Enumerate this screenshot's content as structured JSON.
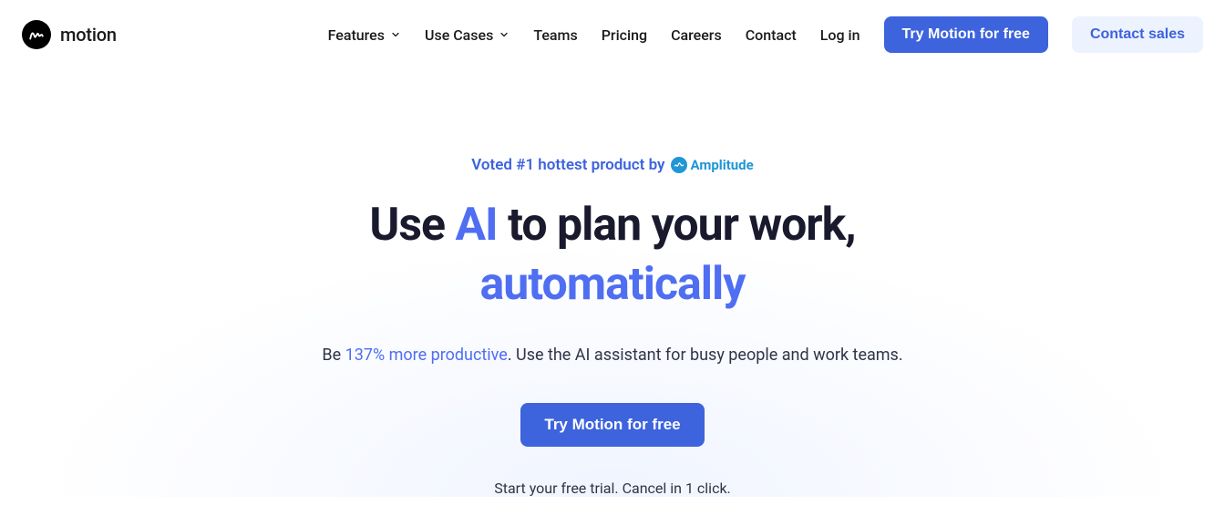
{
  "brand": {
    "name": "motion"
  },
  "nav": {
    "features": "Features",
    "usecases": "Use Cases",
    "teams": "Teams",
    "pricing": "Pricing",
    "careers": "Careers",
    "contact": "Contact",
    "login": "Log in",
    "try": "Try Motion for free",
    "sales": "Contact sales"
  },
  "hero": {
    "badge_prefix": "Voted #1 hottest product by",
    "badge_partner": "Amplitude",
    "headline_pre": "Use ",
    "headline_accent1": "AI",
    "headline_mid": " to plan your work,",
    "headline_accent2": "automatically",
    "sub_pre": "Be ",
    "sub_accent": "137% more productive",
    "sub_post": ". Use the AI assistant for busy people and work teams.",
    "cta": "Try Motion for free",
    "note": "Start your free trial. Cancel in 1 click."
  }
}
